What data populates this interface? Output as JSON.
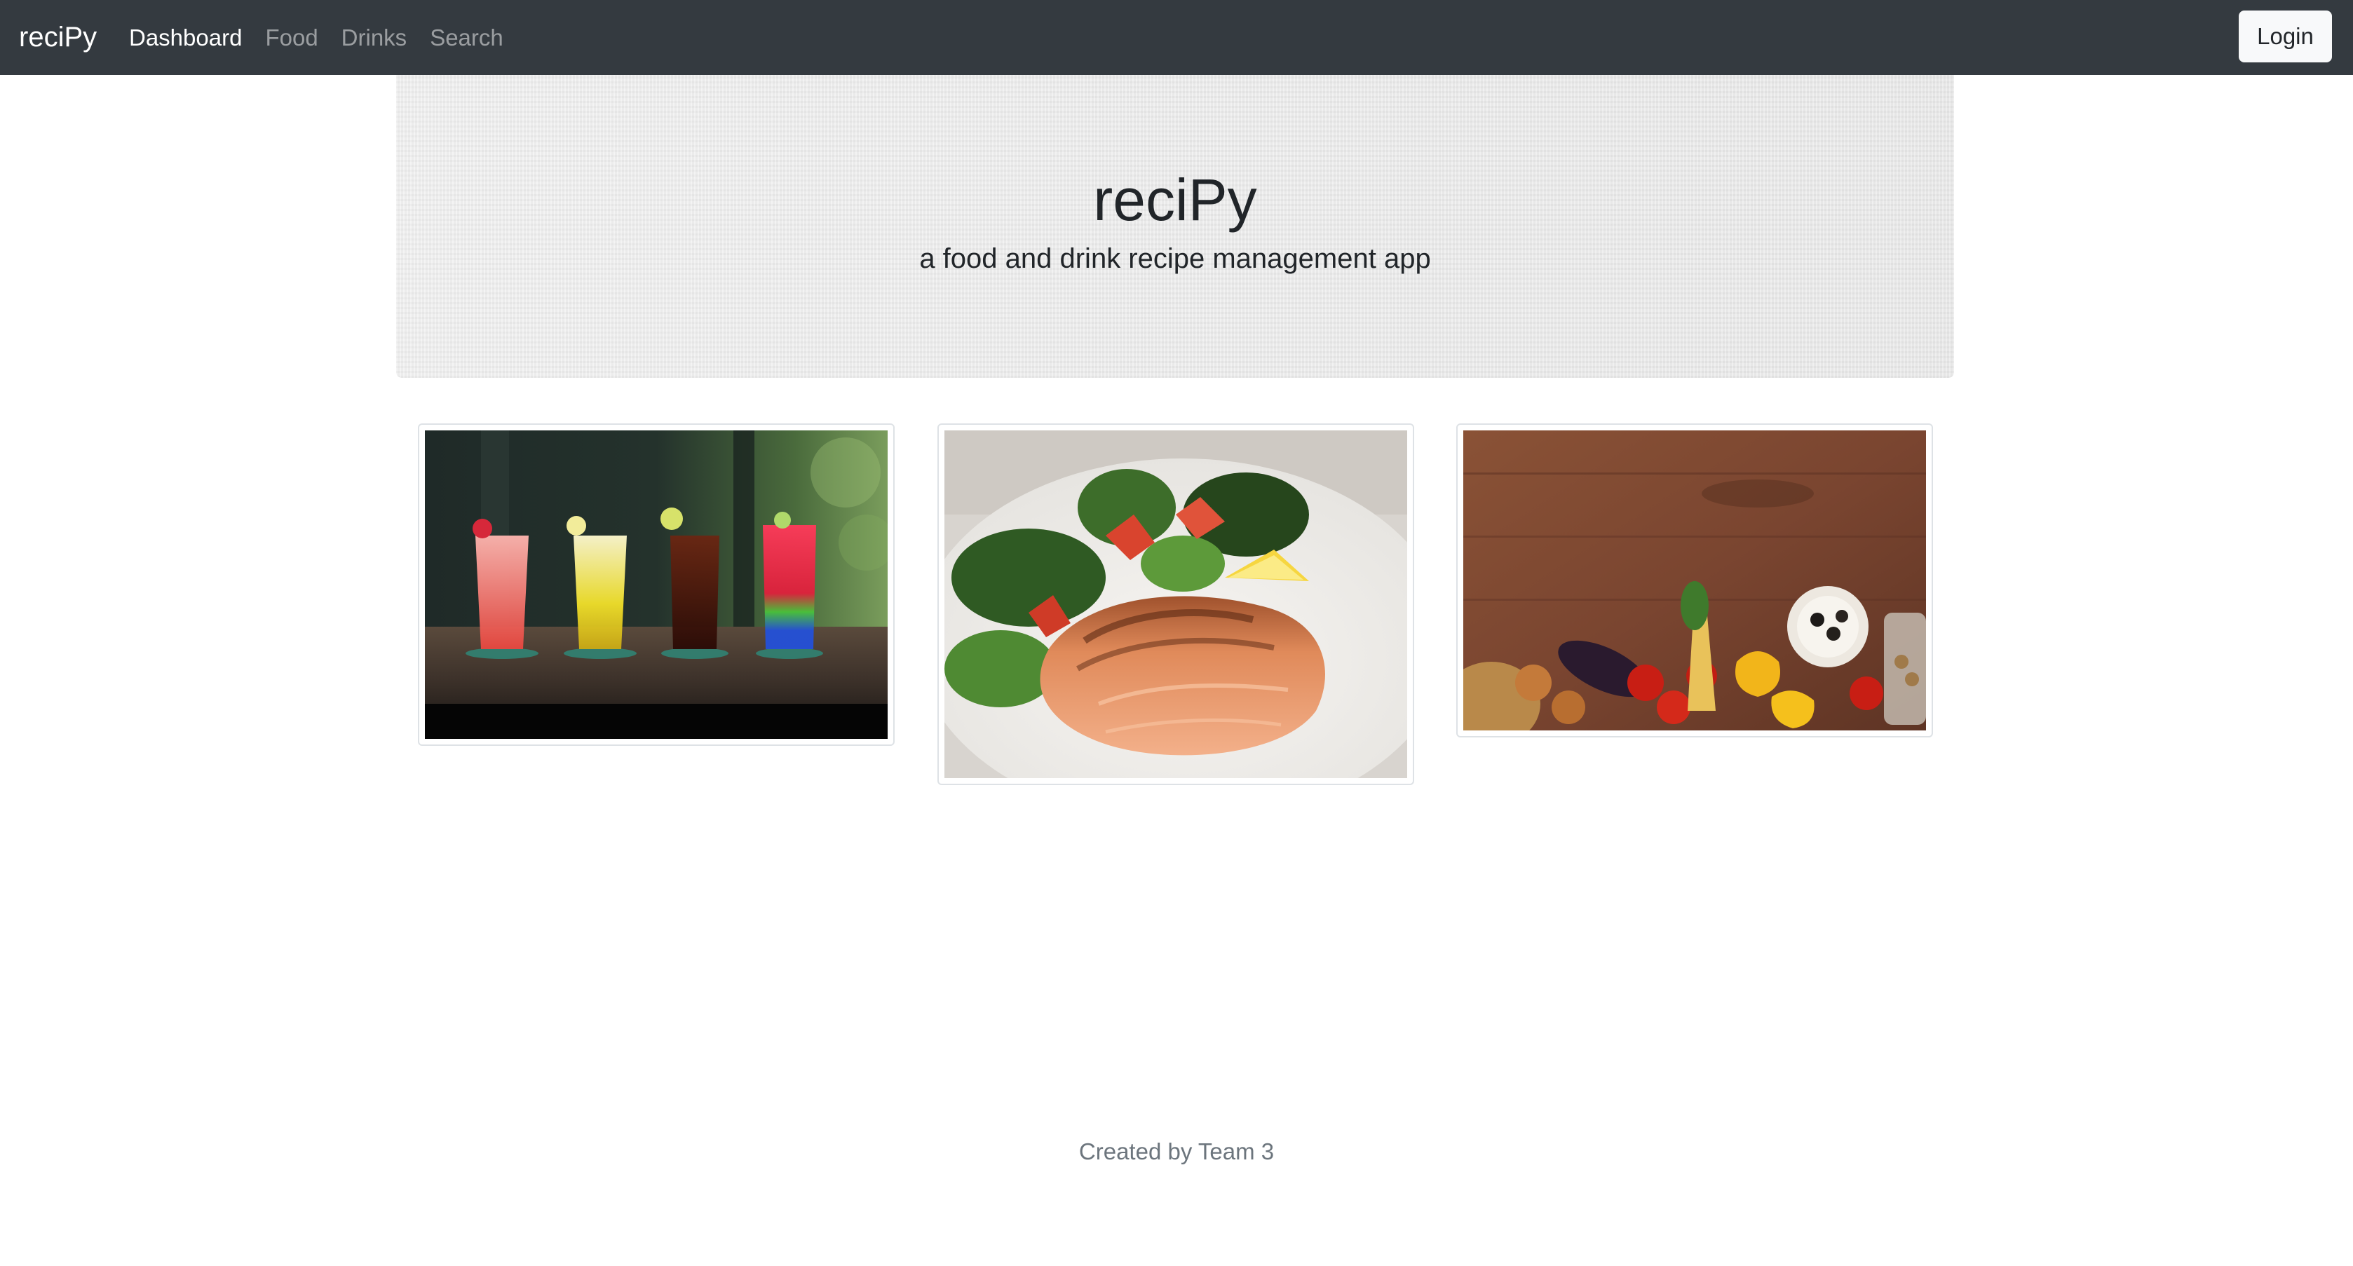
{
  "navbar": {
    "brand": "reciPy",
    "links": [
      {
        "label": "Dashboard",
        "active": true
      },
      {
        "label": "Food",
        "active": false
      },
      {
        "label": "Drinks",
        "active": false
      },
      {
        "label": "Search",
        "active": false
      }
    ],
    "login_label": "Login"
  },
  "hero": {
    "title": "reciPy",
    "subtitle": "a food and drink recipe management app"
  },
  "cards": [
    {
      "image": "cocktails-photo"
    },
    {
      "image": "grilled-salmon-photo"
    },
    {
      "image": "vegetables-on-wood-photo"
    }
  ],
  "footer": {
    "text": "Created by Team 3"
  },
  "colors": {
    "navbar_bg": "#343a40",
    "nav_active": "#ffffff",
    "nav_inactive": "rgba(255,255,255,0.5)",
    "login_bg": "#f8f9fa",
    "footer_text": "#6c757d"
  }
}
